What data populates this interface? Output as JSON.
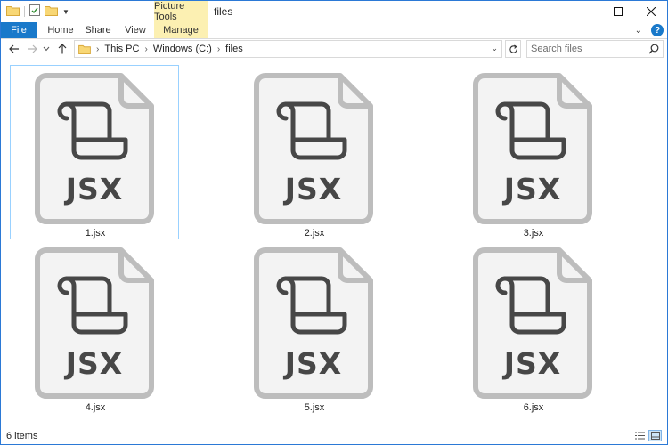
{
  "window": {
    "title": "files",
    "context_tab": "Picture Tools"
  },
  "ribbon": {
    "tabs": [
      "File",
      "Home",
      "Share",
      "View",
      "Manage"
    ]
  },
  "navigation": {
    "breadcrumb": [
      "This PC",
      "Windows (C:)",
      "files"
    ],
    "search_placeholder": "Search files"
  },
  "files": [
    {
      "name": "1.jsx",
      "icon_text": "JSX",
      "selected": true
    },
    {
      "name": "2.jsx",
      "icon_text": "JSX",
      "selected": false
    },
    {
      "name": "3.jsx",
      "icon_text": "JSX",
      "selected": false
    },
    {
      "name": "4.jsx",
      "icon_text": "JSX",
      "selected": false
    },
    {
      "name": "5.jsx",
      "icon_text": "JSX",
      "selected": false
    },
    {
      "name": "6.jsx",
      "icon_text": "JSX",
      "selected": false
    }
  ],
  "status": {
    "item_count": "6 items"
  },
  "icons": {
    "file_type": "script-scroll-icon",
    "folder": "folder-icon"
  },
  "colors": {
    "accent": "#1979ca",
    "context_tab": "#fcf0b2",
    "selection_border": "#99d1ff",
    "icon_fill": "#f3f3f3",
    "icon_border": "#bdbdbd",
    "icon_glyph": "#474747"
  }
}
